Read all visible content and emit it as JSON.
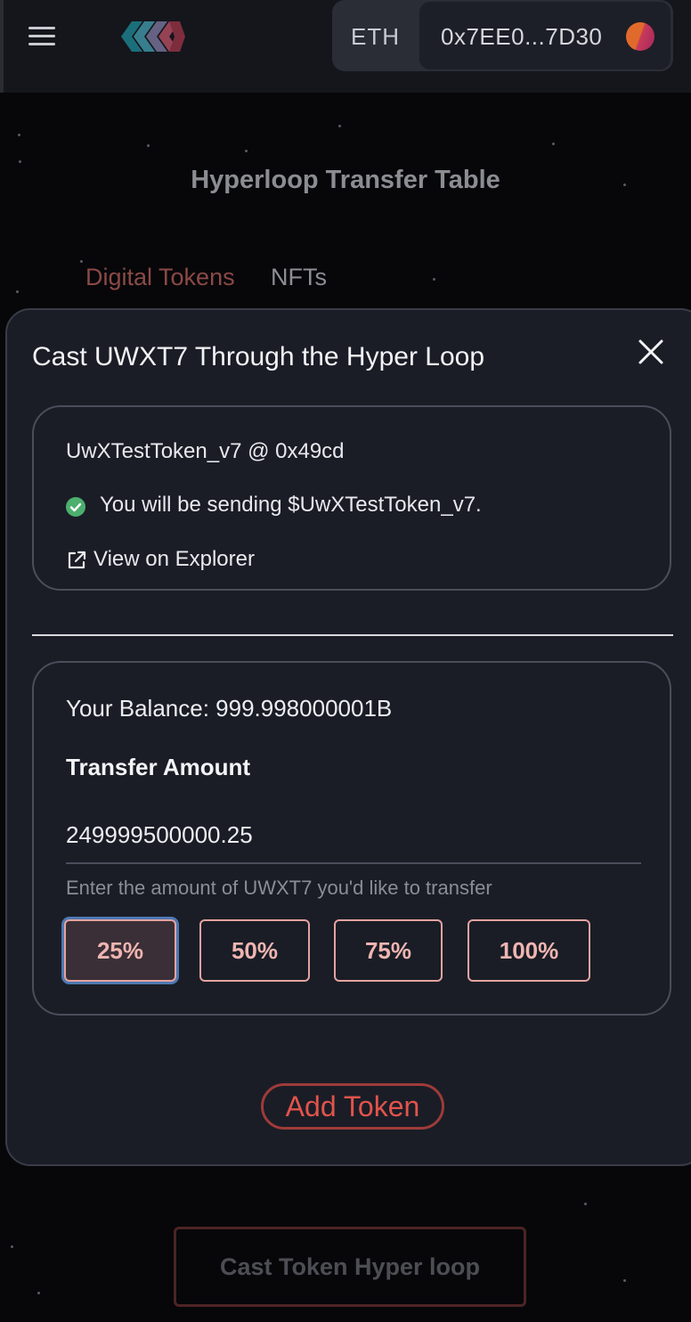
{
  "header": {
    "chain": "ETH",
    "wallet_address": "0x7EE0...7D30"
  },
  "page": {
    "title": "Hyperloop Transfer Table",
    "tabs": [
      {
        "label": "Digital Tokens"
      },
      {
        "label": "NFTs"
      }
    ],
    "cast_button_label": "Cast Token Hyper loop"
  },
  "modal": {
    "title": "Cast UWXT7 Through the Hyper Loop",
    "token_info": {
      "name": "UwXTestToken_v7 @ 0x49cd",
      "sending_message": "You will be sending $UwXTestToken_v7.",
      "explorer_link": "View on Explorer"
    },
    "transfer": {
      "balance": "Your Balance: 999.998000001B",
      "amount_label": "Transfer Amount",
      "amount_value": "249999500000.25",
      "helper_text": "Enter the amount of UWXT7 you'd like to transfer",
      "percent_options": [
        "25%",
        "50%",
        "75%",
        "100%"
      ],
      "selected_percent": "25%"
    },
    "add_token_label": "Add Token"
  },
  "colors": {
    "accent": "#e2534c",
    "success": "#4caf6e",
    "focus_ring": "#4d78b3"
  }
}
